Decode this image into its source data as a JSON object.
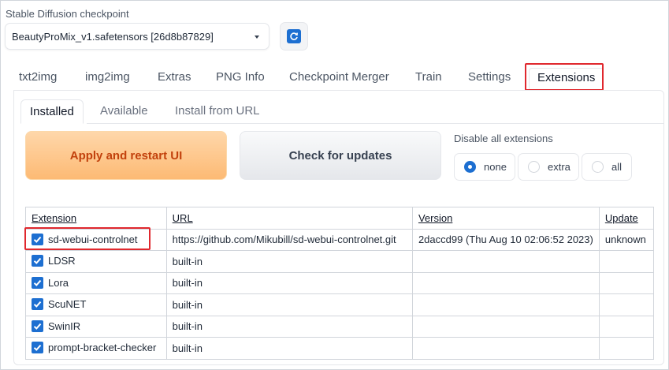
{
  "checkpoint": {
    "label": "Stable Diffusion checkpoint",
    "selected": "BeautyProMix_v1.safetensors [26d8b87829]"
  },
  "main_tabs": [
    {
      "label": "txt2img"
    },
    {
      "label": "img2img"
    },
    {
      "label": "Extras"
    },
    {
      "label": "PNG Info"
    },
    {
      "label": "Checkpoint Merger"
    },
    {
      "label": "Train"
    },
    {
      "label": "Settings"
    },
    {
      "label": "Extensions",
      "active": true
    }
  ],
  "sub_tabs": [
    {
      "label": "Installed",
      "active": true
    },
    {
      "label": "Available"
    },
    {
      "label": "Install from URL"
    }
  ],
  "buttons": {
    "apply": "Apply and restart UI",
    "check": "Check for updates"
  },
  "disable": {
    "label": "Disable all extensions",
    "options": [
      {
        "label": "none",
        "selected": true
      },
      {
        "label": "extra",
        "selected": false
      },
      {
        "label": "all",
        "selected": false
      }
    ]
  },
  "table": {
    "headers": [
      "Extension",
      "URL",
      "Version",
      "Update"
    ],
    "rows": [
      {
        "name": "sd-webui-controlnet",
        "url": "https://github.com/Mikubill/sd-webui-controlnet.git",
        "version": "2daccd99 (Thu Aug 10 02:06:52 2023)",
        "update": "unknown",
        "checked": true
      },
      {
        "name": "LDSR",
        "url": "built-in",
        "version": "",
        "update": "",
        "checked": true
      },
      {
        "name": "Lora",
        "url": "built-in",
        "version": "",
        "update": "",
        "checked": true
      },
      {
        "name": "ScuNET",
        "url": "built-in",
        "version": "",
        "update": "",
        "checked": true
      },
      {
        "name": "SwinIR",
        "url": "built-in",
        "version": "",
        "update": "",
        "checked": true
      },
      {
        "name": "prompt-bracket-checker",
        "url": "built-in",
        "version": "",
        "update": "",
        "checked": true
      }
    ]
  },
  "colors": {
    "accent": "#1d6fd1",
    "highlight": "#e0282e",
    "apply_text": "#c2410c"
  }
}
